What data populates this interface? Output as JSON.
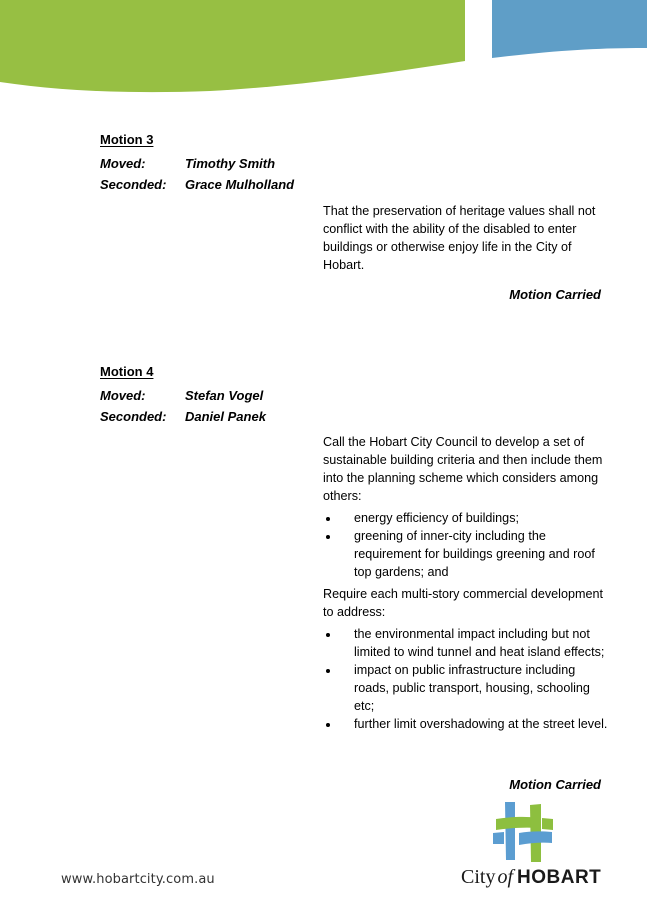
{
  "colors": {
    "green": "#97bf43",
    "blue": "#5f9ec7",
    "logo_green": "#8dbf3f",
    "logo_blue": "#5b9dd1"
  },
  "motions": [
    {
      "heading": "Motion 3",
      "moved_label": "Moved:",
      "moved_by": "Timothy Smith",
      "seconded_label": "Seconded:",
      "seconded_by": "Grace Mulholland",
      "text": "That the preservation of heritage values shall not conflict with the ability of the disabled to enter buildings or otherwise enjoy life in the City of Hobart.",
      "result": "Motion Carried"
    },
    {
      "heading": "Motion 4",
      "moved_label": "Moved:",
      "moved_by": "Stefan Vogel",
      "seconded_label": "Seconded:",
      "seconded_by": "Daniel Panek",
      "intro": "Call the Hobart City Council to develop a set of sustainable building criteria and then include them into the planning scheme which considers among others:",
      "bullets_1": [
        "energy efficiency of buildings;",
        "greening of inner-city including the requirement for buildings greening and roof top gardens; and"
      ],
      "intro_2": "Require each multi-story commercial development to address:",
      "bullets_2": [
        "the environmental impact including but not limited to wind tunnel and heat island effects;",
        "impact on public infrastructure including roads, public transport, housing, schooling etc;",
        "further limit overshadowing at the street level."
      ],
      "result": "Motion Carried"
    }
  ],
  "footer": {
    "url": "www.hobartcity.com.au",
    "logo": {
      "city": "City",
      "of": "of",
      "hobart": "HOBART",
      "icon": "city-of-hobart-woven-cross-logo"
    }
  }
}
